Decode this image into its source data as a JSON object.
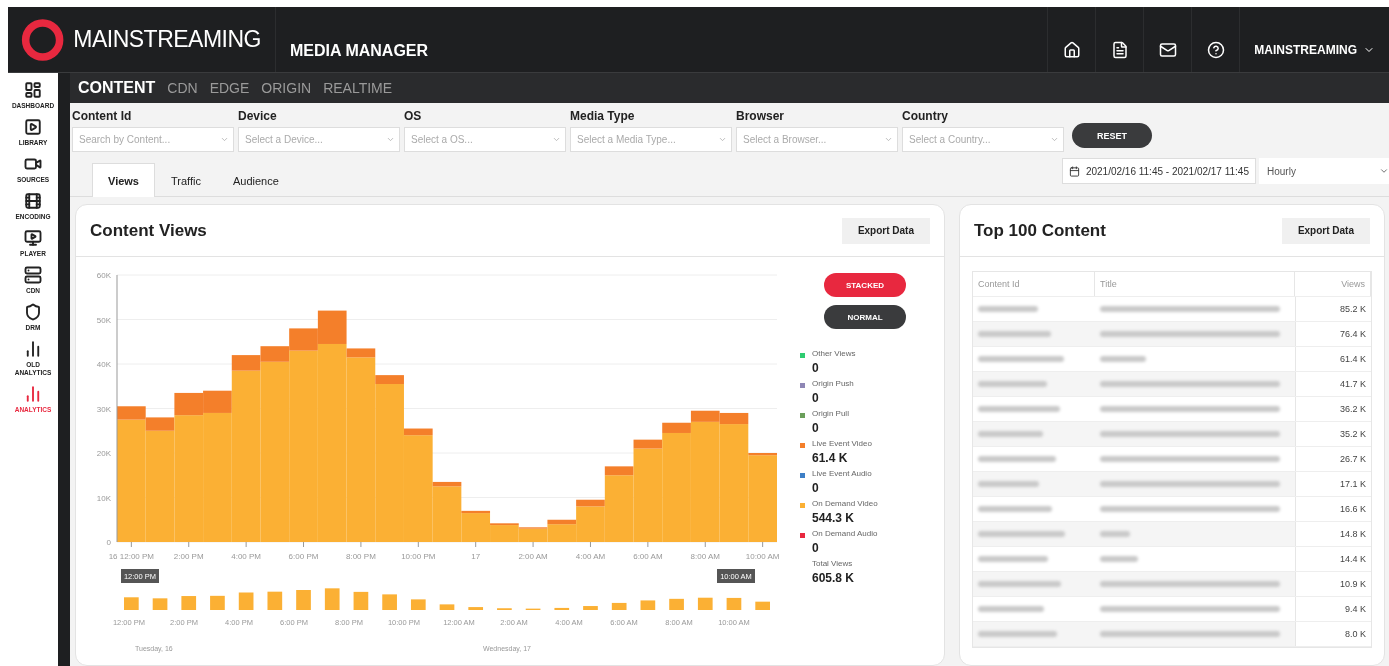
{
  "header": {
    "brand": "MAINSTREAMING",
    "app_title": "MEDIA MANAGER",
    "user_menu": "MAINSTREAMING"
  },
  "sidebar": {
    "items": [
      {
        "label": "DASHBOARD",
        "selected": false
      },
      {
        "label": "LIBRARY",
        "selected": false
      },
      {
        "label": "SOURCES",
        "selected": false
      },
      {
        "label": "ENCODING",
        "selected": false
      },
      {
        "label": "PLAYER",
        "selected": false
      },
      {
        "label": "CDN",
        "selected": false
      },
      {
        "label": "DRM",
        "selected": false
      },
      {
        "label": "OLD ANALYTICS",
        "selected": false
      },
      {
        "label": "ANALYTICS",
        "selected": true
      }
    ]
  },
  "section_tabs": [
    {
      "label": "CONTENT",
      "selected": true
    },
    {
      "label": "CDN",
      "selected": false
    },
    {
      "label": "EDGE",
      "selected": false
    },
    {
      "label": "ORIGIN",
      "selected": false
    },
    {
      "label": "REALTIME",
      "selected": false
    }
  ],
  "filters": [
    {
      "label": "Content Id",
      "placeholder": "Search by Content..."
    },
    {
      "label": "Device",
      "placeholder": "Select a Device..."
    },
    {
      "label": "OS",
      "placeholder": "Select a OS..."
    },
    {
      "label": "Media Type",
      "placeholder": "Select a Media Type..."
    },
    {
      "label": "Browser",
      "placeholder": "Select a Browser..."
    },
    {
      "label": "Country",
      "placeholder": "Select a Country..."
    }
  ],
  "reset_button": "RESET",
  "view_tabs": [
    {
      "label": "Views",
      "selected": true
    },
    {
      "label": "Traffic",
      "selected": false
    },
    {
      "label": "Audience",
      "selected": false
    }
  ],
  "date_range": "2021/02/16 11:45 - 2021/02/17 11:45",
  "interval": "Hourly",
  "content_views": {
    "title": "Content Views",
    "export_button": "Export Data",
    "chart_data": {
      "type": "bar",
      "stacked": true,
      "grid": true,
      "categories": [
        "16 12:00 PM",
        null,
        "2:00 PM",
        null,
        "4:00 PM",
        null,
        "6:00 PM",
        null,
        "8:00 PM",
        null,
        "10:00 PM",
        null,
        "17",
        null,
        "2:00 AM",
        null,
        "4:00 AM",
        null,
        "6:00 AM",
        null,
        "8:00 AM",
        null,
        "10:00 AM"
      ],
      "series": [
        {
          "color": "#fbb034",
          "values": [
            27500,
            25000,
            28500,
            29000,
            38500,
            40500,
            43000,
            44500,
            41500,
            35500,
            24000,
            12500,
            6500,
            3800,
            3000,
            4000,
            8000,
            15000,
            21000,
            24500,
            27000,
            26500,
            19500
          ]
        },
        {
          "color": "#f47f2a",
          "values": [
            3000,
            3000,
            5000,
            5000,
            3500,
            3500,
            5000,
            7500,
            2000,
            2000,
            1500,
            1000,
            500,
            400,
            300,
            1000,
            1500,
            2000,
            2000,
            2300,
            2500,
            2500,
            500
          ]
        }
      ],
      "ylim": [
        0,
        60000
      ],
      "yticks": [
        {
          "value": 0,
          "label": "0"
        },
        {
          "value": 10000,
          "label": "10K"
        },
        {
          "value": 20000,
          "label": "20K"
        },
        {
          "value": 30000,
          "label": "30K"
        },
        {
          "value": 40000,
          "label": "40K"
        },
        {
          "value": 50000,
          "label": "50K"
        },
        {
          "value": 60000,
          "label": "60K"
        }
      ]
    },
    "navigator": {
      "handles": [
        "12:00 PM",
        "10:00 AM"
      ],
      "ticks": [
        "12:00 PM",
        "2:00 PM",
        "4:00 PM",
        "6:00 PM",
        "8:00 PM",
        "10:00 PM",
        "12:00 AM",
        "2:00 AM",
        "4:00 AM",
        "6:00 AM",
        "8:00 AM",
        "10:00 AM"
      ],
      "days": [
        "Tuesday, 16",
        "Wednesday, 17"
      ]
    },
    "modes": [
      {
        "label": "STACKED",
        "selected": true
      },
      {
        "label": "NORMAL",
        "selected": false
      }
    ],
    "legend": [
      {
        "name": "Other Views",
        "value": "0",
        "color": "#2ecc71"
      },
      {
        "name": "Origin Push",
        "value": "0",
        "color": "#8e86b5"
      },
      {
        "name": "Origin Pull",
        "value": "0",
        "color": "#6a9f5a"
      },
      {
        "name": "Live Event Video",
        "value": "61.4 K",
        "color": "#f47f2a"
      },
      {
        "name": "Live Event Audio",
        "value": "0",
        "color": "#3d7fc6"
      },
      {
        "name": "On Demand Video",
        "value": "544.3 K",
        "color": "#fbb034"
      },
      {
        "name": "On Demand Audio",
        "value": "0",
        "color": "#e8283f"
      }
    ],
    "total": {
      "label": "Total Views",
      "value": "605.8 K"
    }
  },
  "top_content": {
    "title": "Top 100 Content",
    "export_button": "Export Data",
    "columns": [
      "Content Id",
      "Title",
      "Views"
    ],
    "rows": [
      {
        "views": "85.2 K"
      },
      {
        "views": "76.4 K"
      },
      {
        "views": "61.4 K"
      },
      {
        "views": "41.7 K"
      },
      {
        "views": "36.2 K"
      },
      {
        "views": "35.2 K"
      },
      {
        "views": "26.7 K"
      },
      {
        "views": "17.1 K"
      },
      {
        "views": "16.6 K"
      },
      {
        "views": "14.8 K"
      },
      {
        "views": "14.4 K"
      },
      {
        "views": "10.9 K"
      },
      {
        "views": "9.4 K"
      },
      {
        "views": "8.0 K"
      }
    ]
  }
}
